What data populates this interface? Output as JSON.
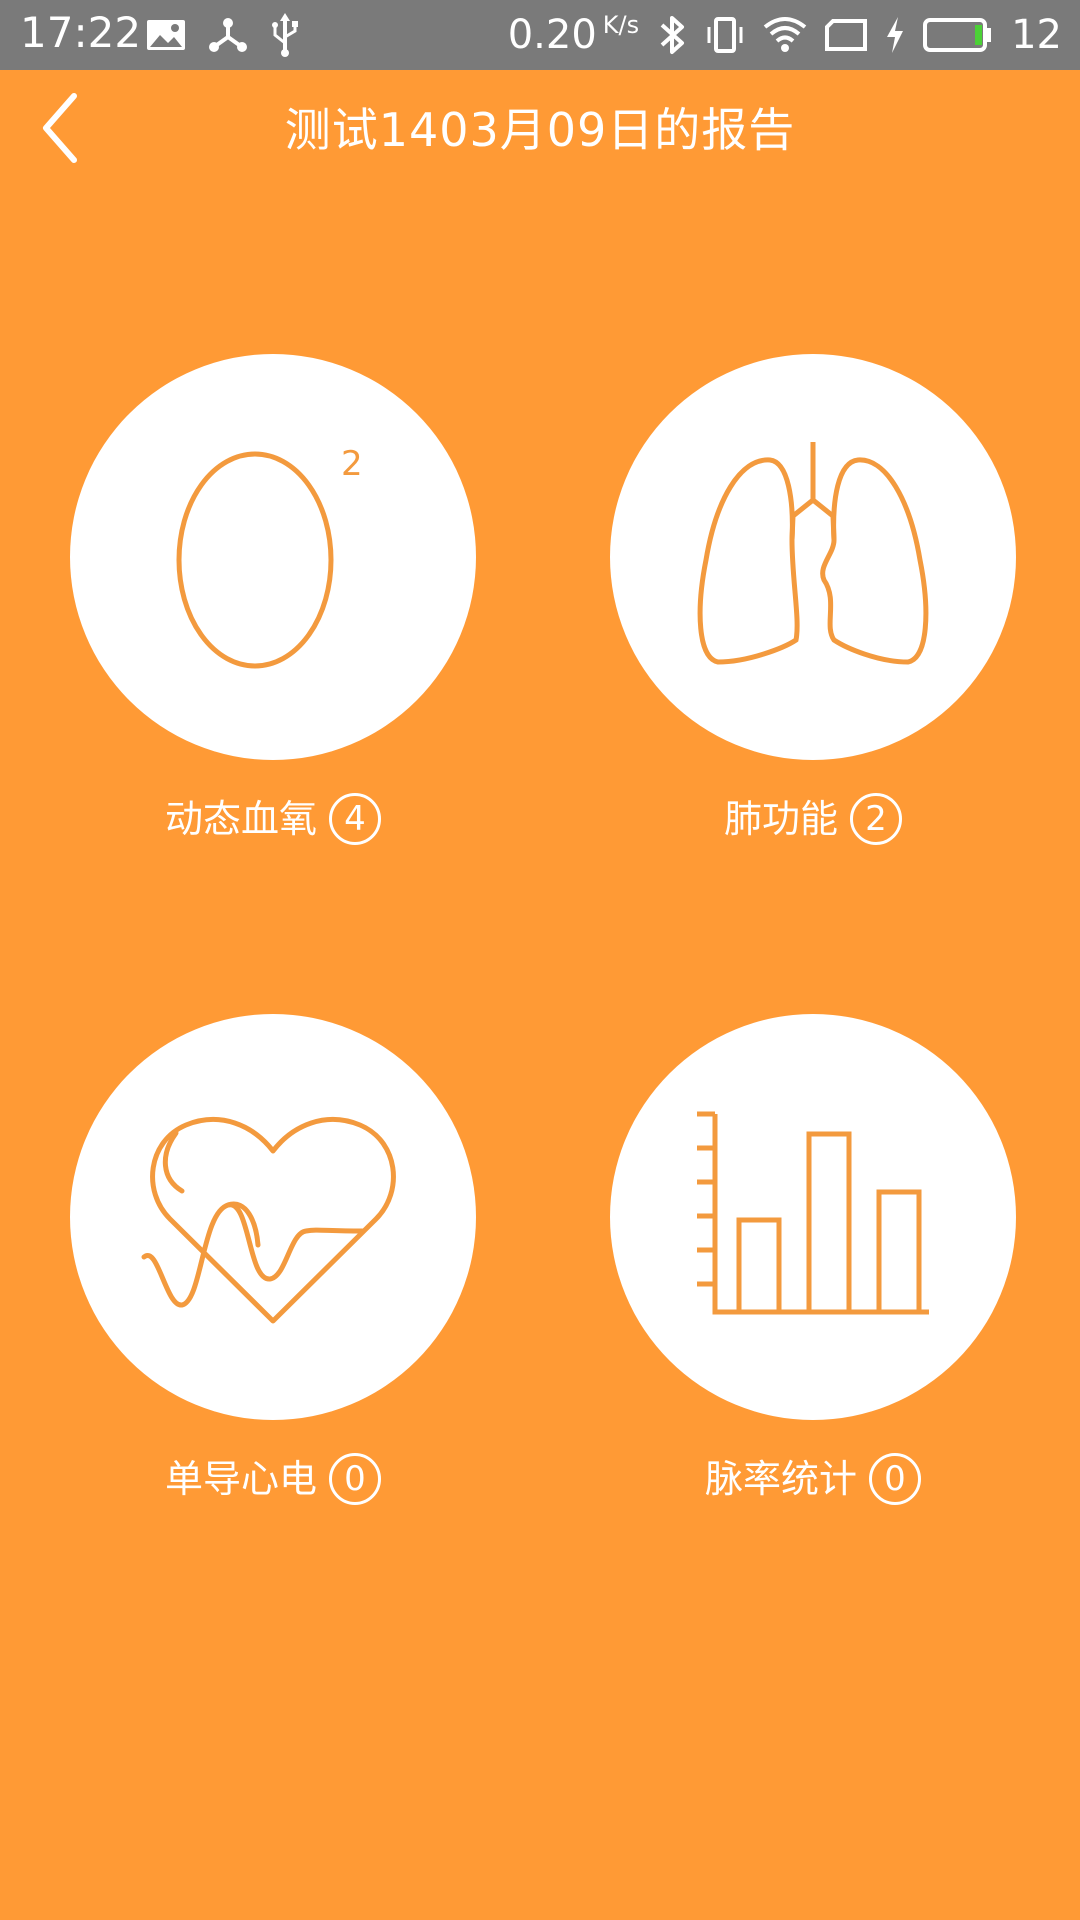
{
  "status_bar": {
    "time": "17:22",
    "net_speed": "0.20",
    "net_speed_unit": "K/s",
    "battery_level": "12",
    "icons_left": [
      "image-icon",
      "share-icon",
      "usb-icon"
    ],
    "icons_right": [
      "bluetooth-icon",
      "vibrate-icon",
      "wifi-icon",
      "sim-icon",
      "charging-icon",
      "battery-icon"
    ]
  },
  "header": {
    "title": "测试1403月09日的报告",
    "back_icon": "chevron-left-icon"
  },
  "tiles": [
    {
      "label": "动态血氧",
      "count": "4",
      "icon": "oxygen-icon"
    },
    {
      "label": "肺功能",
      "count": "2",
      "icon": "lung-icon"
    },
    {
      "label": "单导心电",
      "count": "0",
      "icon": "heart-ecg-icon"
    },
    {
      "label": "脉率统计",
      "count": "0",
      "icon": "bar-chart-icon"
    }
  ],
  "colors": {
    "background": "#FF9A35",
    "status_bar": "#7a7a7a",
    "icon_stroke": "#F39A3E",
    "text": "#ffffff",
    "battery_fill": "#4CD137"
  }
}
